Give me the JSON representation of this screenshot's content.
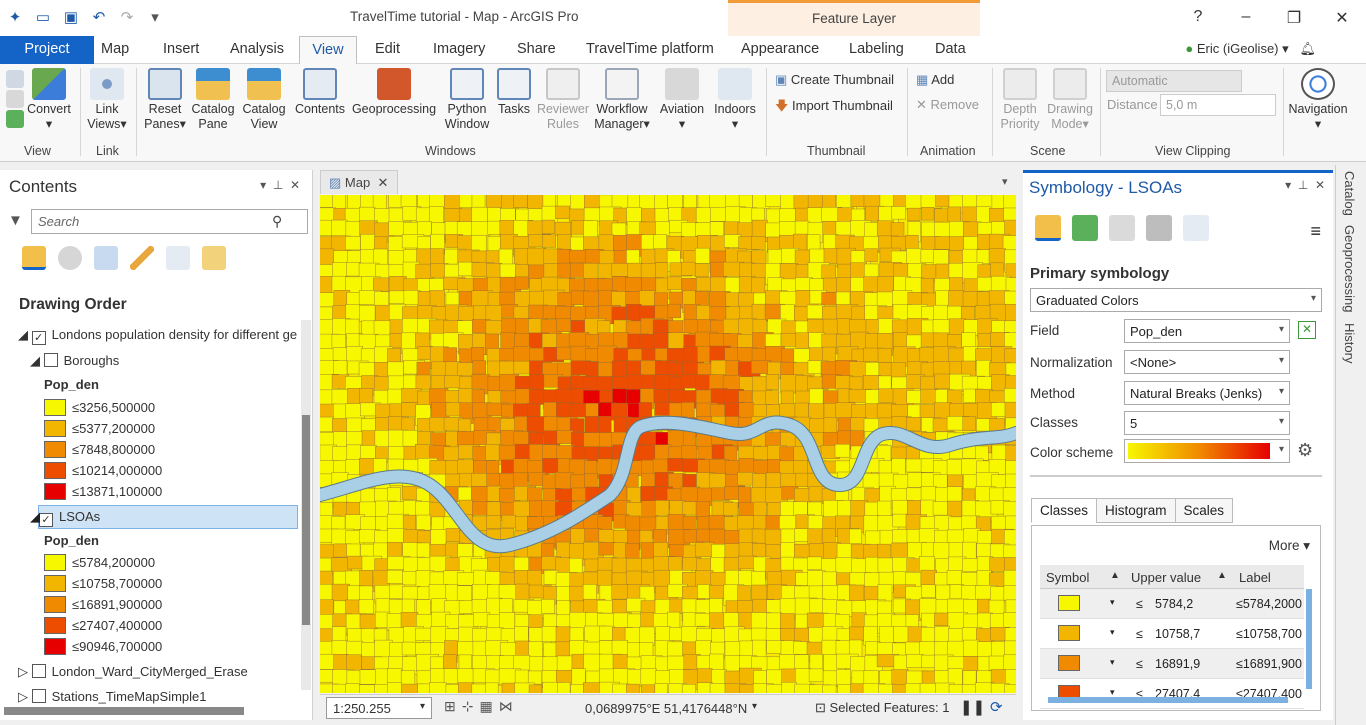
{
  "app": {
    "title": "TravelTime tutorial - Map - ArcGIS Pro",
    "context_tab": "Feature Layer",
    "help": "?",
    "user": "Eric (iGeolise)"
  },
  "tabs": [
    "Project",
    "Map",
    "Insert",
    "Analysis",
    "View",
    "Edit",
    "Imagery",
    "Share",
    "TravelTime platform",
    "Appearance",
    "Labeling",
    "Data"
  ],
  "ribbon": {
    "convert": "Convert",
    "link_views": "Link\nViews",
    "reset_panes": "Reset\nPanes",
    "catalog_pane": "Catalog\nPane",
    "catalog_view": "Catalog\nView",
    "contents": "Contents",
    "geoprocessing": "Geoprocessing",
    "python_window": "Python\nWindow",
    "tasks": "Tasks",
    "reviewer_rules": "Reviewer\nRules",
    "workflow_manager": "Workflow\nManager",
    "aviation": "Aviation",
    "indoors": "Indoors",
    "create_thumbnail": "Create Thumbnail",
    "import_thumbnail": "Import Thumbnail",
    "add": "Add",
    "remove": "Remove",
    "depth_priority": "Depth\nPriority",
    "drawing_mode": "Drawing\nMode",
    "automatic": "Automatic",
    "distance_label": "Distance",
    "distance_value": "5,0  m",
    "navigation": "Navigation",
    "groups": {
      "view": "View",
      "link": "Link",
      "windows": "Windows",
      "thumbnail": "Thumbnail",
      "animation": "Animation",
      "scene": "Scene",
      "view_clipping": "View Clipping"
    }
  },
  "contents": {
    "title": "Contents",
    "search_placeholder": "Search",
    "drawing_order": "Drawing Order",
    "layer1": "Londons population density for different ge",
    "boroughs": "Boroughs",
    "field1": "Pop_den",
    "boroughs_classes": [
      {
        "label": "≤3256,500000",
        "color": "#f7f700"
      },
      {
        "label": "≤5377,200000",
        "color": "#f2b600"
      },
      {
        "label": "≤7848,800000",
        "color": "#f08a00"
      },
      {
        "label": "≤10214,000000",
        "color": "#ed4d00"
      },
      {
        "label": "≤13871,100000",
        "color": "#e60000"
      }
    ],
    "lsoas": "LSOAs",
    "field2": "Pop_den",
    "lsoa_classes": [
      {
        "label": "≤5784,200000",
        "color": "#f7f700"
      },
      {
        "label": "≤10758,700000",
        "color": "#f2b600"
      },
      {
        "label": "≤16891,900000",
        "color": "#f08a00"
      },
      {
        "label": "≤27407,400000",
        "color": "#ed4d00"
      },
      {
        "label": "≤90946,700000",
        "color": "#e60000"
      }
    ],
    "ward_layer": "London_Ward_CityMerged_Erase",
    "stations_layer": "Stations_TimeMapSimple1"
  },
  "map": {
    "tab": "Map",
    "scale": "1:250.255",
    "coords": "0,0689975°E 51,4176448°N",
    "selected": "Selected Features: 1"
  },
  "symbology": {
    "title": "Symbology - LSOAs",
    "primary": "Primary symbology",
    "type": "Graduated Colors",
    "field_label": "Field",
    "field_value": "Pop_den",
    "norm_label": "Normalization",
    "norm_value": "<None>",
    "method_label": "Method",
    "method_value": "Natural Breaks (Jenks)",
    "classes_label": "Classes",
    "classes_value": "5",
    "scheme_label": "Color scheme",
    "subtabs": [
      "Classes",
      "Histogram",
      "Scales"
    ],
    "more": "More",
    "headers": [
      "Symbol",
      "Upper value",
      "Label"
    ],
    "rows": [
      {
        "le": "≤",
        "value": "5784,2",
        "label": "≤5784,2000",
        "color": "#f7f700"
      },
      {
        "le": "≤",
        "value": "10758,7",
        "label": "≤10758,700",
        "color": "#f2b600"
      },
      {
        "le": "≤",
        "value": "16891,9",
        "label": "≤16891,900",
        "color": "#f08a00"
      },
      {
        "le": "≤",
        "value": "27407,4",
        "label": "≤27407,400",
        "color": "#ed4d00"
      }
    ]
  },
  "rail": [
    "Catalog",
    "Geoprocessing",
    "History"
  ]
}
